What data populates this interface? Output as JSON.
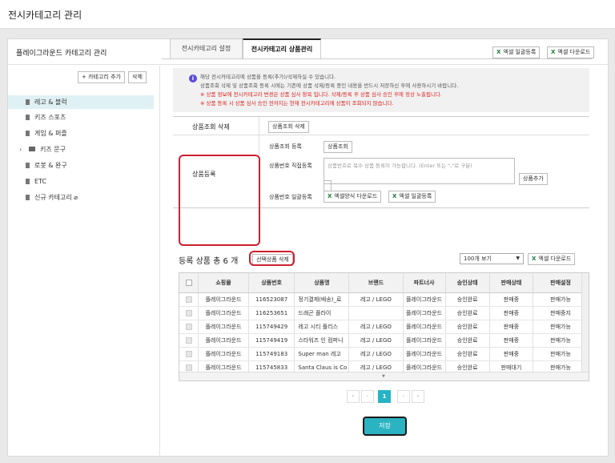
{
  "page_title": "전시카테고리 관리",
  "card_title": "플레이그라운드 카테고리 관리",
  "header_buttons": {
    "excel_bulk_register": "엑셀 일괄등록",
    "excel_download": "엑셀 다운로드"
  },
  "sidebar": {
    "add_category": "+ 카테고리 추가",
    "delete": "삭제",
    "items": [
      "레고 & 블럭",
      "키즈 스포츠",
      "게임 & 퍼즐",
      "키즈 문구",
      "로봇 & 완구",
      "ETC",
      "신규 카테고리 ⌀"
    ]
  },
  "tabs": [
    "전시카테고리 설정",
    "전시카테고리 상품관리"
  ],
  "notice": [
    "해당 전시카테고리에 상품을 등록(추가)/삭제하실 수 있습니다.",
    "상품조회 삭제 및 상품조회 등록 시에는 기존에 상품 삭제/등록 중인 내용을 반드시 저장하신 후에 사용하시기 바랍니다.",
    "※ 상품 정보에 전시카테고리 변경은 상품 심사 항목 입니다. 삭제/등록 후 상품 심사 승인 후에 정상 노출됩니다.",
    "※ 상품 등록 시 상품 심사 승인 전까지는 현재 전시카테고리에 상품이 조회되지 않습니다."
  ],
  "form": {
    "search_delete_label": "상품조회 삭제",
    "search_delete_btn": "상품조회 삭제",
    "register_label": "상품등록",
    "search_register_label": "상품조회 등록",
    "search_btn": "상품조회",
    "direct_label": "상품번호 직접등록",
    "direct_placeholder": "상품번호로 복수 상품 등록이 가능합니다. (Enter 또는 \",\"로 구분)",
    "add_btn": "상품추가",
    "bulk_label": "상품번호 일괄등록",
    "template_download": "엑셀양식 다운로드",
    "bulk_register": "엑셀 일괄등록"
  },
  "list": {
    "title_prefix": "등록 상품 총",
    "count": "6 개",
    "delete_selected": "선택상품 삭제",
    "page_size": "100개 보기",
    "excel_download": "엑셀 다운로드"
  },
  "table": {
    "columns": [
      "쇼핑몰",
      "상품번호",
      "상품명",
      "브랜드",
      "파트너사",
      "승인상태",
      "판매상태",
      "판매설정"
    ],
    "rows": [
      [
        "플레이그라운드",
        "116523087",
        "정기결제(배송)_로",
        "레고 / LEGO",
        "플레이그라운드",
        "승인완료",
        "판매중",
        "판매가능"
      ],
      [
        "플레이그라운드",
        "116253651",
        "드래곤 플라이",
        "",
        "플레이그라운드",
        "승인완료",
        "판매중",
        "판매중지"
      ],
      [
        "플레이그라운드",
        "115749429",
        "레고 시티 폴리스",
        "레고 / LEGO",
        "플레이그라운드",
        "승인완료",
        "판매중",
        "판매가능"
      ],
      [
        "플레이그라운드",
        "115749419",
        "스타워즈 인 컴퍼니",
        "레고 / LEGO",
        "플레이그라운드",
        "승인완료",
        "판매중",
        "판매가능"
      ],
      [
        "플레이그라운드",
        "115749183",
        "Super man 레고",
        "레고 / LEGO",
        "플레이그라운드",
        "승인완료",
        "판매중",
        "판매가능"
      ],
      [
        "플레이그라운드",
        "115745833",
        "Santa Claus is Co",
        "레고 / LEGO",
        "플레이그라운드",
        "승인완료",
        "판매대기",
        "판매가능"
      ]
    ]
  },
  "pagination": {
    "first": "«",
    "prev": "‹",
    "current": "1",
    "next": "›",
    "last": "»"
  },
  "save": "저장",
  "colors": {
    "accent": "#2bb3c2",
    "highlight": "#cc2030",
    "excel": "#1f7a3a"
  }
}
